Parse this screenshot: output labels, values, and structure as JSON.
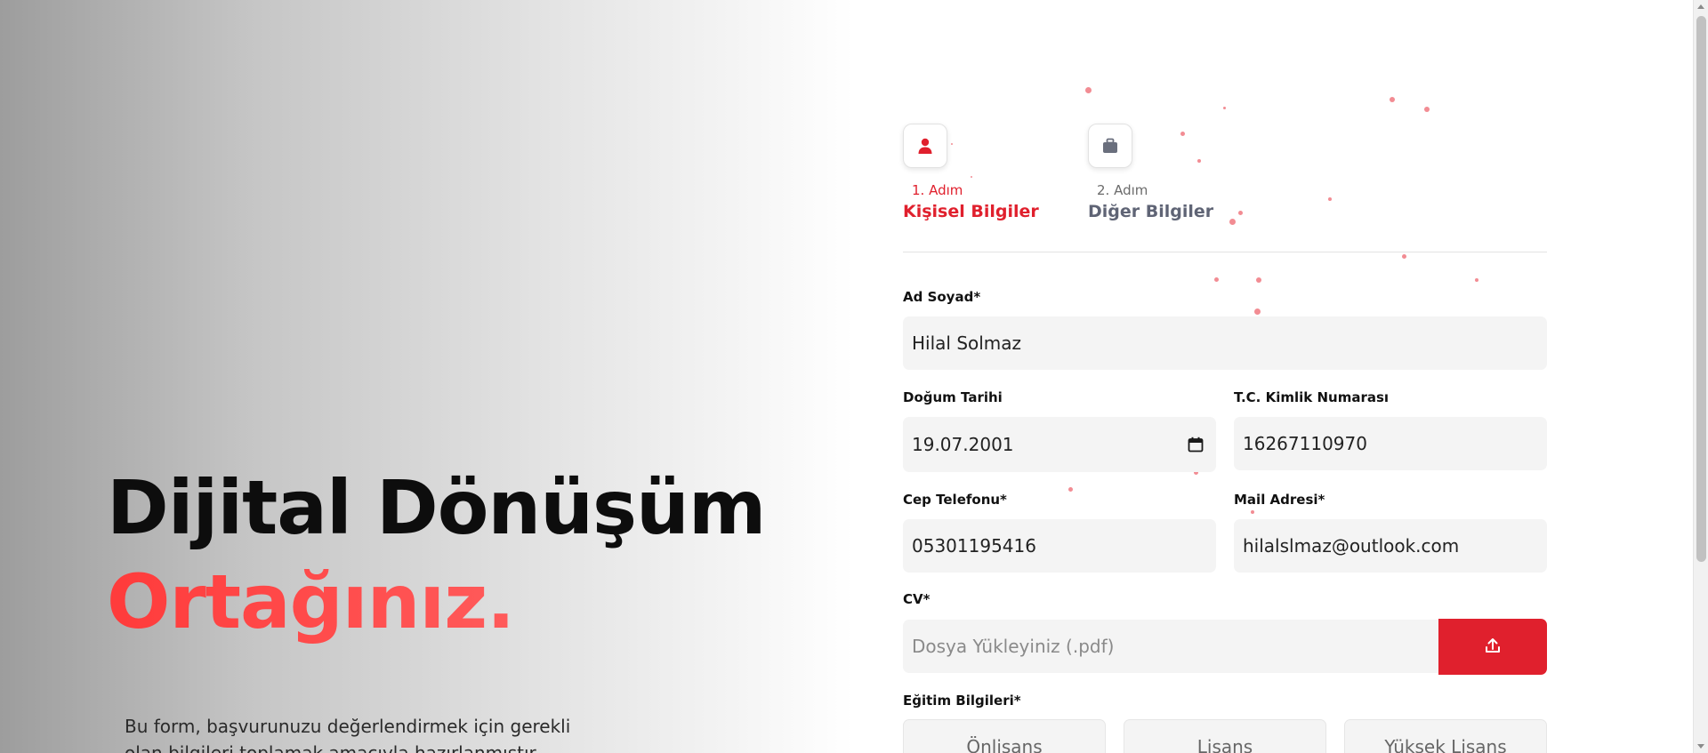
{
  "hero": {
    "title_line1": "Dijital Dönüşüm",
    "title_line2": "Ortağınız.",
    "description": "Bu form, başvurunuzu değerlendirmek için gerekli olan bilgileri toplamak amacıyla hazırlanmıştır."
  },
  "steps": [
    {
      "number": "1. Adım",
      "name": "Kişisel Bilgiler",
      "icon": "user-icon",
      "active": true
    },
    {
      "number": "2. Adım",
      "name": "Diğer Bilgiler",
      "icon": "briefcase-icon",
      "active": false
    }
  ],
  "form": {
    "full_name": {
      "label": "Ad Soyad*",
      "value": "Hilal Solmaz"
    },
    "birth_date": {
      "label": "Doğum Tarihi",
      "value": "19.07.2001"
    },
    "tc_id": {
      "label": "T.C. Kimlik Numarası",
      "value": "16267110970"
    },
    "phone": {
      "label": "Cep Telefonu*",
      "value": "05301195416"
    },
    "email": {
      "label": "Mail Adresi*",
      "value": "hilalslmaz@outlook.com"
    },
    "cv": {
      "label": "CV*",
      "placeholder": "Dosya Yükleyiniz (.pdf)"
    },
    "education": {
      "label": "Eğitim Bilgileri*",
      "options": [
        "Önlisans",
        "Lisans",
        "Yüksek Lisans"
      ]
    }
  },
  "colors": {
    "accent": "#e0202d",
    "hero_accent": "#ff4d4d",
    "field_bg": "#f4f4f4"
  }
}
